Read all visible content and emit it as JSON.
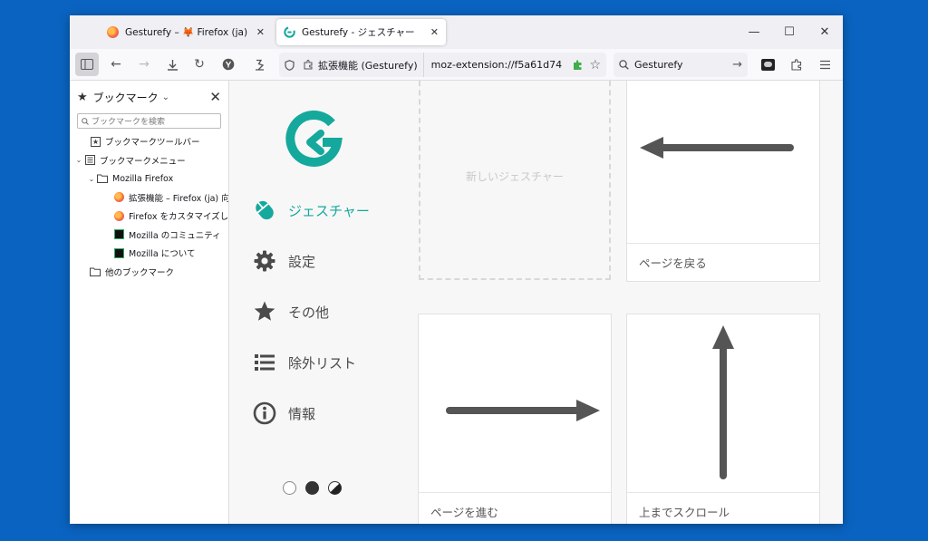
{
  "tabs": [
    {
      "title": "Gesturefy – 🦊 Firefox (ja) 向け拡張",
      "close": "✕",
      "favicon_color": "#e66000"
    },
    {
      "title": "Gesturefy - ジェスチャー",
      "close": "✕",
      "favicon_color": "#14a99c"
    }
  ],
  "window_controls": {
    "minimize": "—",
    "maximize": "☐",
    "close": "✕"
  },
  "toolbar": {
    "identity_label": "拡張機能 (Gesturefy)",
    "url": "moz-extension://f5a61d74",
    "search_value": "Gesturefy"
  },
  "sidebar": {
    "title": "ブックマーク",
    "search_placeholder": "ブックマークを検索",
    "items": [
      {
        "label": "ブックマークツールバー",
        "level": 1,
        "twisty": "",
        "icon": "toolbar-icon"
      },
      {
        "label": "ブックマークメニュー",
        "level": 0,
        "twisty": "⌄",
        "icon": "menu-icon"
      },
      {
        "label": "Mozilla Firefox",
        "level": 1,
        "twisty": "⌄",
        "icon": "folder-icon"
      },
      {
        "label": "拡張機能 – Firefox (ja) 向け…",
        "level": 3,
        "twisty": "",
        "icon": "firefox-icon"
      },
      {
        "label": "Firefox をカスタマイズし…",
        "level": 3,
        "twisty": "",
        "icon": "firefox-icon"
      },
      {
        "label": "Mozilla のコミュニティ",
        "level": 3,
        "twisty": "",
        "icon": "mozilla-icon"
      },
      {
        "label": "Mozilla について",
        "level": 3,
        "twisty": "",
        "icon": "mozilla-icon"
      },
      {
        "label": "他のブックマーク",
        "level": 0,
        "twisty": "",
        "icon": "folder-icon"
      }
    ]
  },
  "nav": {
    "gestures": "ジェスチャー",
    "settings": "設定",
    "other": "その他",
    "exclusions": "除外リスト",
    "about": "情報"
  },
  "gestures": {
    "new_gesture": "新しいジェスチャー",
    "page_back": "ページを戻る",
    "page_forward": "ページを進む",
    "scroll_top": "上までスクロール"
  },
  "colors": {
    "accent": "#14a99c",
    "desktop": "#0a63c0",
    "arrow": "#555555"
  }
}
